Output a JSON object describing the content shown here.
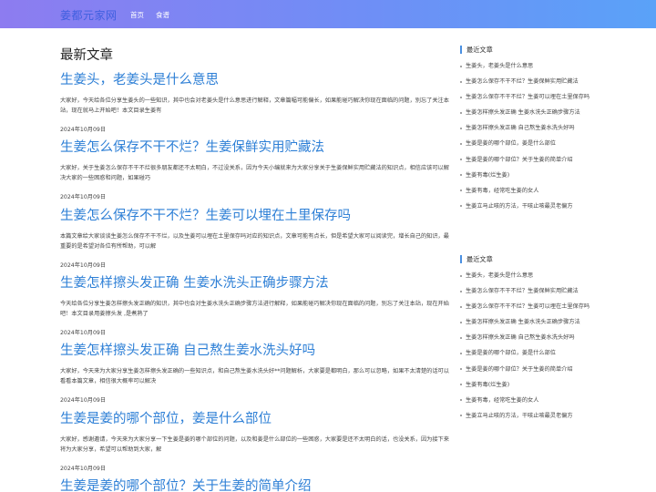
{
  "header": {
    "logo": "姜都元家网",
    "nav": [
      "首页",
      "食谱"
    ]
  },
  "main": {
    "section_title": "最新文章",
    "articles": [
      {
        "title": "生姜头，老姜头是什么意思",
        "summary": "大家好，今天给各位分享生姜头的一些知识，其中也会对老姜头是什么意思进行解释，文章篇幅可能偏长，如果能碰巧解决你现在面临的问题，别忘了关注本站，现在就马上开始吧！本文目录生姜有",
        "date": "2024年10月09日"
      },
      {
        "title": "生姜怎么保存不干不烂？生姜保鲜实用贮藏法",
        "summary": "大家好，关于生姜怎么保存不干不烂很多朋友都还不太明白，不过没关系，因为今天小编就来为大家分享关于生姜保鲜实用贮藏法的知识点，相信应该可以解决大家的一些困惑和问题，如果碰巧",
        "date": "2024年10月09日"
      },
      {
        "title": "生姜怎么保存不干不烂？生姜可以埋在土里保存吗",
        "summary": "本篇文章给大家谈谈生姜怎么保存不干不烂，以及生姜可以埋在土里保存吗对应的知识点，文章可能有点长，但是希望大家可以阅读完，增长自己的知识，最重要的是希望对各位有所帮助，可以解",
        "date": "2024年10月09日"
      },
      {
        "title": "生姜怎样擦头发正确 生姜水洗头正确步骤方法",
        "summary": "今天给各位分享生姜怎样擦头发正确的知识，其中也会对生姜水洗头正确步骤方法进行解释，如果能碰巧解决你现在面临的问题，别忘了关注本站，现在开始吧！本文目录用姜擦头发 ,是煮熟了",
        "date": "2024年10月09日"
      },
      {
        "title": "生姜怎样擦头发正确 自己熬生姜水洗头好吗",
        "summary": "大家好，今天来为大家分享生姜怎样擦头发正确的一些知识点，和自己熬生姜水洗头好**问题解析，大家要是都明白，那么可以忽略，如果不太清楚的话可以看看本篇文章，相信很大概率可以解决",
        "date": "2024年10月09日"
      },
      {
        "title": "生姜是姜的哪个部位，姜是什么部位",
        "summary": "大家好，感谢邀请，今天来为大家分享一下生姜是姜的哪个部位的问题，以及和姜是什么部位的一些困惑，大家要是还不太明白的话，也没关系，因为接下来将为大家分享，希望可以帮助到大家，解",
        "date": "2024年10月09日"
      },
      {
        "title": "生姜是姜的哪个部位？关于生姜的简单介绍",
        "summary": "",
        "date": ""
      }
    ]
  },
  "sidebar": {
    "blocks": [
      {
        "title": "最近文章",
        "items": [
          "生姜头，老姜头是什么意思",
          "生姜怎么保存不干不烂？生姜保鲜实用贮藏法",
          "生姜怎么保存不干不烂？生姜可以埋在土里保存吗",
          "生姜怎样擦头发正确 生姜水洗头正确步骤方法",
          "生姜怎样擦头发正确 自己熬生姜水洗头好吗",
          "生姜是姜的哪个部位，姜是什么部位",
          "生姜是姜的哪个部位？关于生姜的简单介绍",
          "生姜有毒(烂生姜)",
          "生姜有毒，经常吃生姜的女人",
          "生姜立马止咳的方法，干咳止咳最灵老偏方"
        ]
      },
      {
        "title": "最近文章",
        "items": [
          "生姜头，老姜头是什么意思",
          "生姜怎么保存不干不烂？生姜保鲜实用贮藏法",
          "生姜怎么保存不干不烂？生姜可以埋在土里保存吗",
          "生姜怎样擦头发正确 生姜水洗头正确步骤方法",
          "生姜怎样擦头发正确 自己熬生姜水洗头好吗",
          "生姜是姜的哪个部位，姜是什么部位",
          "生姜是姜的哪个部位？关于生姜的简单介绍",
          "生姜有毒(烂生姜)",
          "生姜有毒，经常吃生姜的女人",
          "生姜立马止咳的方法，干咳止咳最灵老偏方"
        ]
      }
    ]
  }
}
